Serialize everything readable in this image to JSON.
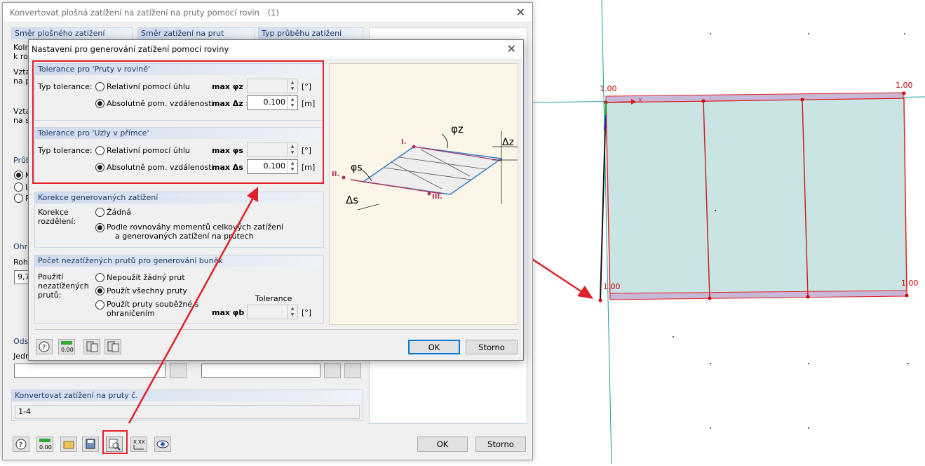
{
  "back_dialog": {
    "title": "Konvertovat plošná zatížení na zatížení na pruty pomocí rovin",
    "title_suffix": "(1)",
    "headers": {
      "surface_load_dir": "Směr plošného zatížení",
      "member_load_dir": "Směr zatížení na prut",
      "load_distribution": "Typ průběhu zatížení"
    },
    "partial_texts": [
      "Kolm",
      "k rov",
      "Vzta",
      "na p",
      "Vzta",
      "na sl",
      "Průb",
      "K",
      "L",
      "P",
      "Ohra",
      "Rohe",
      "Odst",
      "Jedn"
    ],
    "field_value": "9,7",
    "convert_header": "Konvertovat zatížení na pruty č.",
    "convert_value": "1-4",
    "ok_label": "OK",
    "cancel_label": "Storno"
  },
  "front_dialog": {
    "title": "Nastavení pro generování zatížení pomocí roviny",
    "members_group": {
      "header": "Tolerance pro 'Pruty v rovině'",
      "type_label": "Typ tolerance:",
      "option_relative": "Relativní pomocí úhlu",
      "option_absolute": "Absolutně pom. vzdálenosti",
      "max_phi_label": "max φz :",
      "max_delta_label": "max Δz :",
      "phi_unit": "[°]",
      "delta_value": "0.100",
      "delta_unit": "[m]"
    },
    "nodes_group": {
      "header": "Tolerance pro 'Uzly v přímce'",
      "type_label": "Typ tolerance:",
      "option_relative": "Relativní pomocí úhlu",
      "option_absolute": "Absolutně pom. vzdálenosti",
      "max_phi_label": "max φs :",
      "max_delta_label": "max Δs :",
      "phi_unit": "[°]",
      "delta_value": "0.100",
      "delta_unit": "[m]"
    },
    "correction_group": {
      "header": "Korekce generovaných zatížení",
      "label": "Korekce rozdělení:",
      "option_none": "Žádná",
      "option_balance_1": "Podle rovnováhy momentů celkových zatížení",
      "option_balance_2": "a generovaných zatížení na prutech"
    },
    "unloaded_group": {
      "header": "Počet nezatížených prutů pro generování buněk",
      "label": "Použití nezatížených prutů:",
      "option_none": "Nepoužít žádný prut",
      "option_all": "Použít všechny pruty",
      "option_parallel_1": "Použít pruty souběžné s",
      "option_parallel_2": "ohraničením",
      "tolerance_label": "Tolerance",
      "max_phi_label": "max φb :",
      "phi_unit": "[°]"
    },
    "diagram_labels": {
      "p1": "I.",
      "p2": "II.",
      "p3": "III.",
      "phi_z": "φz",
      "phi_s": "φs",
      "delta_z": "Δz",
      "delta_s": "Δs"
    },
    "ok_label": "OK",
    "cancel_label": "Storno"
  },
  "model": {
    "values": [
      "1.00",
      "1.00",
      "1.00",
      "1.00"
    ],
    "axis_x": "x",
    "axis_z": "z"
  },
  "colors": {
    "accent_red": "#e0202a",
    "surface_fill": "#c9e4e4",
    "header_blue": "#cfdbed"
  }
}
